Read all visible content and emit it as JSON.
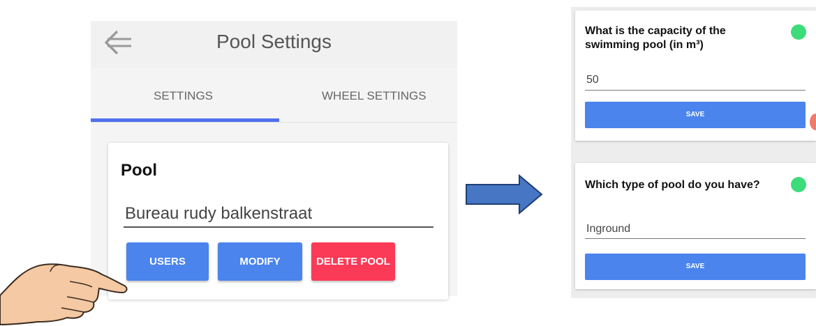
{
  "left": {
    "header": {
      "title": "Pool Settings",
      "back_icon": "arrow-left-icon"
    },
    "tabs": [
      {
        "label": "SETTINGS",
        "active": true
      },
      {
        "label": "WHEEL SETTINGS",
        "active": false
      }
    ],
    "card": {
      "title": "Pool",
      "name_value": "Bureau rudy balkenstraat",
      "buttons": {
        "users": "USERS",
        "modify": "MODIFY",
        "delete": "DELETE POOL"
      }
    }
  },
  "arrow_icon": "right-arrow-icon",
  "hand_icon": "pointing-hand-icon",
  "right": {
    "questions": [
      {
        "text": "What is the capacity of the swimming pool (in m³)",
        "value": "50",
        "save_label": "SAVE",
        "status": "green"
      },
      {
        "text": "Which type of pool do you have?",
        "value": "Inground",
        "save_label": "SAVE",
        "status": "green"
      }
    ]
  },
  "colors": {
    "primary_button": "#4a84ec",
    "danger_button": "#fb3a57",
    "tab_indicator": "#4f6ff0",
    "status_green": "#3ddc7a",
    "arrow_fill": "#4676c4",
    "arrow_stroke": "#1f3f73"
  }
}
